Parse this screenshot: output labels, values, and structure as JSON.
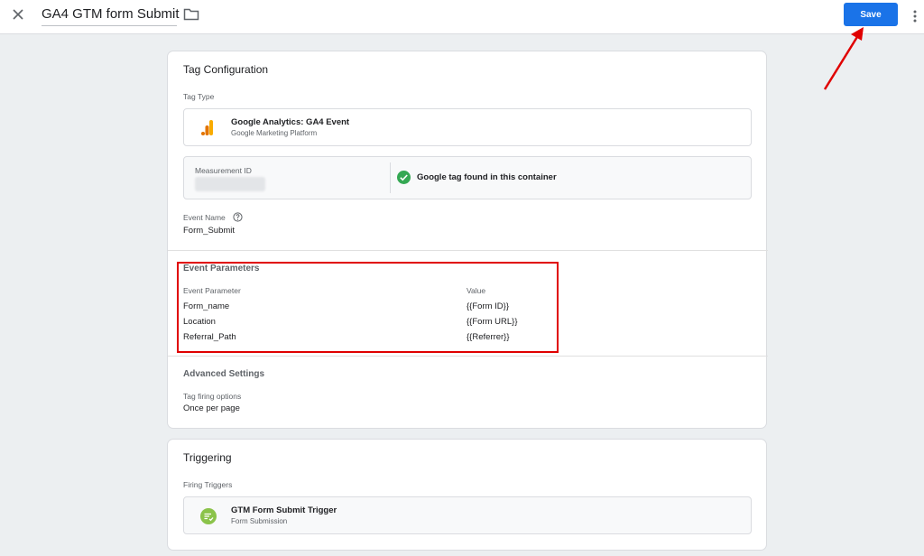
{
  "header": {
    "title": "GA4 GTM form Submit",
    "save_label": "Save"
  },
  "tag_config": {
    "heading": "Tag Configuration",
    "tag_type_label": "Tag Type",
    "tag_type_name": "Google Analytics: GA4 Event",
    "tag_type_sub": "Google Marketing Platform",
    "measurement_id_label": "Measurement ID",
    "google_tag_status": "Google tag found in this container",
    "event_name_label": "Event Name",
    "event_name_value": "Form_Submit",
    "event_params_heading": "Event Parameters",
    "event_param_col": "Event Parameter",
    "value_col": "Value",
    "params": [
      {
        "name": "Form_name",
        "value": "{{Form ID}}"
      },
      {
        "name": "Location",
        "value": "{{Form URL}}"
      },
      {
        "name": "Referral_Path",
        "value": "{{Referrer}}"
      }
    ],
    "advanced_heading": "Advanced Settings",
    "firing_options_label": "Tag firing options",
    "firing_options_value": "Once per page"
  },
  "triggering": {
    "heading": "Triggering",
    "firing_triggers_label": "Firing Triggers",
    "trigger_name": "GTM Form Submit Trigger",
    "trigger_type": "Form Submission"
  },
  "colors": {
    "accent": "#1a73e8",
    "success": "#34a853",
    "highlight": "#e00000",
    "ga_orange": "#f9ab00",
    "ga_dark_orange": "#e37400",
    "trigger_green": "#8bc34a"
  }
}
